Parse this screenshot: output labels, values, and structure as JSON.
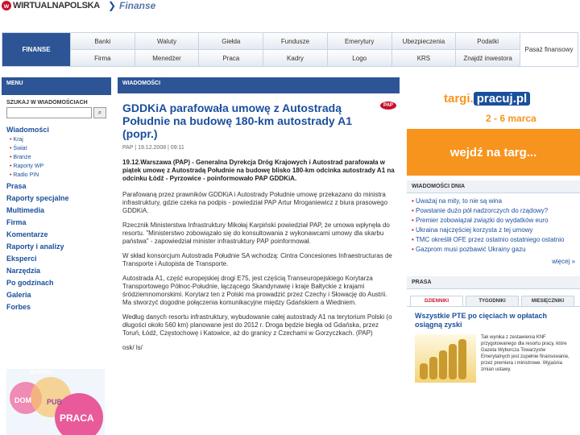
{
  "header": {
    "logo_text": "WIRTUALNAPOLSKA",
    "logo_mark": "w",
    "section_title": "Finanse"
  },
  "nav": {
    "home_label": "FINANSE",
    "row1": [
      "Banki",
      "Waluty",
      "Giełda",
      "Fundusze",
      "Emerytury",
      "Ubezpieczenia",
      "Podatki"
    ],
    "row2": [
      "Firma",
      "Menedżer",
      "Praca",
      "Kadry",
      "Logo",
      "KRS",
      "Znajdź inwestora"
    ],
    "last_label": "Pasaż finansowy"
  },
  "menu": {
    "header": "MENU",
    "search_label": "SZUKAJ W WIADOMOŚCIACH",
    "search_value": "",
    "news_label": "Wiadomości",
    "news_sub": [
      "Kraj",
      "Świat",
      "Branże",
      "Raporty WP",
      "Radio PIN"
    ],
    "sections": [
      "Prasa",
      "Raporty specjalne",
      "Multimedia",
      "Firma",
      "Komentarze",
      "Raporty i analizy",
      "Eksperci",
      "Narzędzia",
      "Po godzinach",
      "Galeria",
      "Forbes"
    ],
    "promo": {
      "label1": "BUDOWE",
      "label2": "DOM",
      "label3": "PUB",
      "label4": "PRACA"
    }
  },
  "article": {
    "header": "WIADOMOŚCI",
    "title": "GDDKiA parafowała umowę z Autostradą Południe na budowę 180-km autostrady A1 (popr.)",
    "badge": "PAP",
    "meta": "PAP | 19.12.2008 | 09:11",
    "lead": "19.12.Warszawa (PAP) - Generalna Dyrekcja Dróg Krajowych i Autostrad parafowała w piątek umowę z Autostradą Południe na budowę blisko 180-km odcinka autostrady A1 na odcinku Łódź - Pyrzowice - poinformowało PAP GDDKiA.",
    "paragraphs": [
      "Parafowaną przez prawników GDDKiA i Autostrady Południe umowę przekazano do ministra infrastruktury, gdzie czeka na podpis - powiedział PAP Artur Mroganiewicz z biura prasowego GDDKiA.",
      "Rzecznik Ministerstwa Infrastruktury Mikołaj Karpiński powiedział PAP, że umowa wpłynęła do resortu. \"Ministerstwo zobowiązało się do konsultowania z wykonawcami umowy dla skarbu państwa\" - zapowiedział minister infrastruktury PAP poinformował.",
      "W skład konsorcjum Autostrada Południe SA wchodzą: Cintra Concesiones Infraestructuras de Transporte i Autopista de Transporte.",
      "Autostrada A1, część europejskiej drogi E75, jest częścią Transeuropejskiego Korytarza Transportowego Północ-Południe, łączącego Skandynawię i kraje Bałtyckie z krajami śródziemnomorskimi. Korytarz ten z Polski ma prowadzić przez Czechy i Słowację do Austrii. Ma stworzyć dogodne połączenia komunikacyjne między Gdańskiem a Wiedniem.",
      "Według danych resortu infrastruktury, wybudowanie całej autostrady A1 na terytorium Polski (o długości około 560 km) planowane jest do 2012 r. Droga będzie biegła od Gdańska, przez Toruń, Łódź, Częstochowę i Katowice, aż do granicy z Czechami w Gorzyczkach. (PAP)",
      "osk/ ls/"
    ]
  },
  "right": {
    "ad": {
      "logo_prefix": "targi.",
      "logo_box": "pracuj.pl",
      "dates": "2 - 6 marca",
      "cta": "wejdź na targ..."
    },
    "news_header": "WIADOMOŚCI DNIA",
    "news": [
      "Uważaj na mity, to nie są wina",
      "Powstanie dużo pół nadzorczych do rządowy?",
      "Premier zobowiązał związki do wydatków euro",
      "Ukraina najczęściej korzysta z tej umowy",
      "TMC określił OFE przez ostatnio ostatniego ostatnio",
      "Gazprom musi pozbawić Ukrainy gazu"
    ],
    "more": "więcej »",
    "press_header": "PRASA",
    "tabs": [
      "DZIENNIKI",
      "TYGODNIKI",
      "MIESIĘCZNIKI"
    ],
    "press_title": "Wszystkie PTE po cięciach w opłatach osiągną zyski",
    "press_text": "Tak wynika z zestawienia KNF przygotowanego dla resortu pracy, które Gazeta Wyborcza Towarzystw Emerytalnych jest zupełnie finansowanie, przez premiera i ministrowe. Wyjaśnia zmian ustawy."
  },
  "colors": {
    "brand": "#2d5596",
    "accent": "#c8102e",
    "orange": "#f7941d"
  },
  "icons": {
    "search_button": "search-icon"
  }
}
